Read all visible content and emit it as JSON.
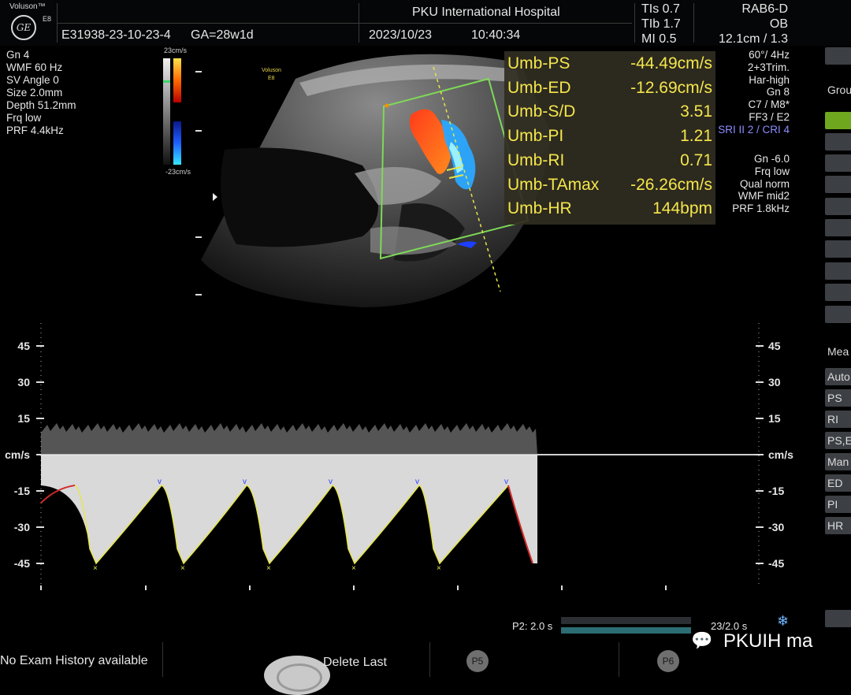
{
  "header": {
    "brand": "Voluson™",
    "model": "E8",
    "logo_text": "GE",
    "hospital": "PKU International Hospital",
    "patient_id": "E31938-23-10-23-4",
    "ga": "GA=28w1d",
    "date": "2023/10/23",
    "time": "10:40:34",
    "tis": "TIs  0.7",
    "tib": "TIb  1.7",
    "mi": "MI  0.5",
    "probe": "RAB6-D",
    "app": "OB",
    "depth_zoom": "12.1cm / 1.3"
  },
  "left_params": [
    "Gn  4",
    "WMF 60 Hz",
    "SV Angle  0",
    "Size  2.0mm",
    "Depth 51.2mm",
    "Frq low",
    "PRF  4.4kHz"
  ],
  "right_params_top": [
    "60°/  4Hz",
    "2+3Trim.",
    "Har-high",
    "Gn  8",
    "C7 / M8*",
    "FF3 / E2"
  ],
  "right_params_cri": "SRI II 2 / CRI 4",
  "right_params_bottom": [
    "Gn -6.0",
    "Frq low",
    "Qual norm",
    "WMF mid2",
    "PRF  1.8kHz"
  ],
  "image_overlay": {
    "brand": "Voluson",
    "model": "E8"
  },
  "colorbar": {
    "top": "23cm/s",
    "bottom": "-23cm/s"
  },
  "measurements": [
    {
      "label": "Umb-PS",
      "value": "-44.49cm/s"
    },
    {
      "label": "Umb-ED",
      "value": "-12.69cm/s"
    },
    {
      "label": "Umb-S/D",
      "value": "3.51"
    },
    {
      "label": "Umb-PI",
      "value": "1.21"
    },
    {
      "label": "Umb-RI",
      "value": "0.71"
    },
    {
      "label": "Umb-TAmax",
      "value": "-26.26cm/s"
    },
    {
      "label": "Umb-HR",
      "value": "144bpm"
    }
  ],
  "doppler": {
    "scale_labels": [
      "45",
      "30",
      "15",
      "cm/s",
      "-15",
      "-30",
      "-45"
    ],
    "scale_values": [
      45,
      30,
      15,
      0,
      -15,
      -30,
      -45
    ],
    "waveform_peaks_cms": [
      -45,
      -45,
      -45,
      -45,
      -45
    ],
    "waveform_ed_cms": [
      -12.7,
      -12.7,
      -12.7,
      -12.7,
      -12.7
    ]
  },
  "bottom": {
    "history": "No Exam History available",
    "delete_last": "Delete Last",
    "p5": "P5",
    "p6": "P6",
    "sweep": "P2:  2.0 s",
    "sweep_right": "23/2.0 s",
    "watermark": "PKUIH ma"
  },
  "right_panel": {
    "group_label": "Grou",
    "measure_label": "Mea",
    "items": [
      "Auto",
      "PS",
      "RI",
      "PS,E",
      "Man",
      "ED",
      "PI",
      "HR"
    ]
  },
  "colors": {
    "measure_text": "#f4e64a",
    "sample_box": "#7ed957",
    "trace_yellow": "#e6e64a",
    "trace_red": "#d22a2a",
    "cri_text": "#8c8cff",
    "active_button": "#6fa81e"
  }
}
